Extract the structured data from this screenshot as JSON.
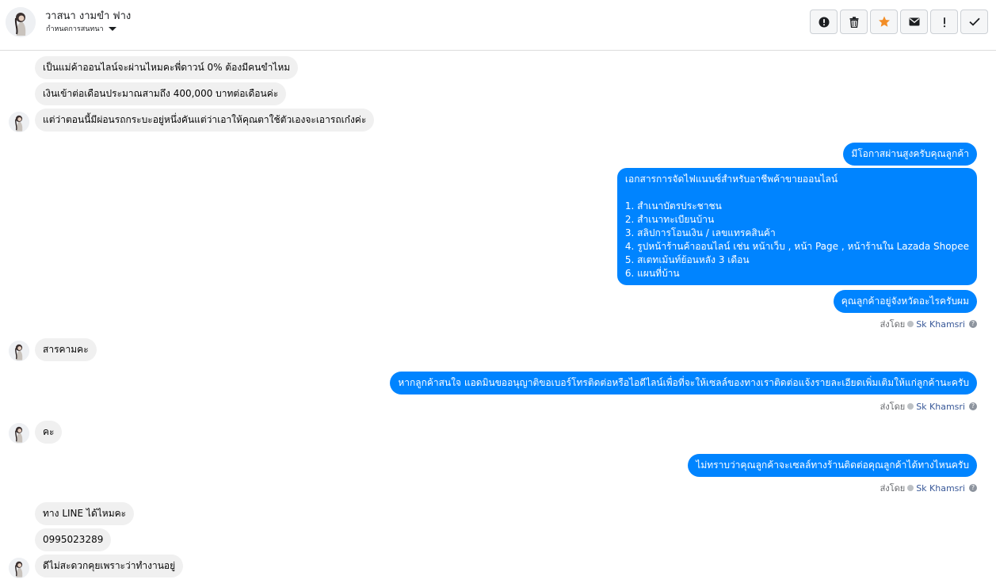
{
  "header": {
    "contact_name": "วาสนา งามขำ ฟาง",
    "subtitle": "กำหนดการสนทนา",
    "actions": [
      {
        "icon": "alert-circle-icon"
      },
      {
        "icon": "trash-icon"
      },
      {
        "icon": "star-icon",
        "color": "#f28d26"
      },
      {
        "icon": "envelope-icon"
      },
      {
        "icon": "exclamation-icon"
      },
      {
        "icon": "checkmark-icon"
      }
    ]
  },
  "messages": [
    {
      "side": "in",
      "text": "เป็นแม่ค้าออนไลน์จะผ่านไหมคะพี่ดาวน์ 0% ต้องมีคนขำไหม"
    },
    {
      "side": "in",
      "text": "เงินเข้าต่อเดือนประมาณสามถึง 400,000 บาทต่อเดือนค่ะ"
    },
    {
      "side": "in",
      "text": "แต่ว่าตอนนี้มีผ่อนรถกระบะอยู่หนึ่งคันแต่ว่าเอาให้คุณตาใช้ตัวเองจะเอารถเก๋งค่ะ"
    },
    {
      "side": "out",
      "text": "มีโอกาสผ่านสูงครับคุณลูกค้า"
    },
    {
      "side": "out",
      "text": "เอกสารการจัดไฟแนนซ์สำหรับอาชีพค้าขายออนไลน์\n\n1. สำเนาบัตรประชาชน\n2. สำเนาทะเบียนบ้าน\n3. สลิปการโอนเงิน / เลขแทรคสินค้า\n4. รูปหน้าร้านค้าออนไลน์ เช่น หน้าเว็บ , หน้า Page , หน้าร้านใน Lazada Shopee\n5. สเตทเม้นท์ย้อนหลัง 3 เดือน\n6. แผนที่บ้าน"
    },
    {
      "side": "out",
      "text": "คุณลูกค้าอยู่จังหวัดอะไรครับผม"
    },
    {
      "side": "in",
      "text": "สารคามคะ"
    },
    {
      "side": "out",
      "text": "หากลูกค้าสนใจ แอดมินขออนุญาติขอเบอร์โทรติดต่อหรือไอดีไลน์เพื่อที่จะให้เซลล์ของทางเราติดต่อแจ้งรายละเอียดเพิ่มเติมให้แก่ลูกค้านะครับ"
    },
    {
      "side": "in",
      "text": "คะ"
    },
    {
      "side": "out",
      "text": "ไม่ทราบว่าคุณลูกค้าจะเซลล์ทางร้านติดต่อคุณลูกค้าได้ทางไหนครับ"
    },
    {
      "side": "in",
      "text": "ทาง LINE ได้ไหมคะ"
    },
    {
      "side": "in",
      "text": "0995023289"
    },
    {
      "side": "in",
      "text": "ดีไม่สะดวกคุยเพราะว่าทำงานอยู่"
    }
  ],
  "sent_by": {
    "label": "ส่งโดย",
    "sender": "Sk Khamsri",
    "help": "?"
  }
}
